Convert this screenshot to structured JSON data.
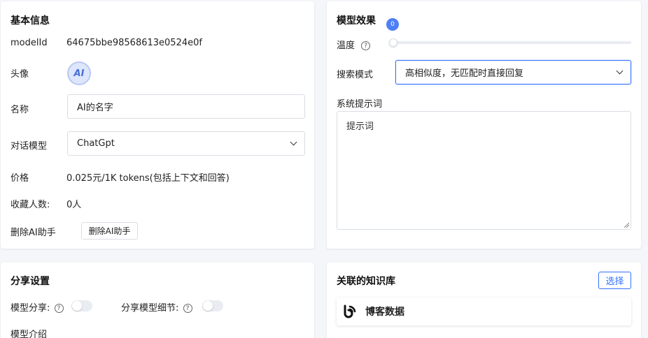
{
  "basic": {
    "title": "基本信息",
    "model_id_label": "modelId",
    "model_id_value": "64675bbe98568613e0524e0f",
    "avatar_label": "头像",
    "avatar_text": "AI",
    "name_label": "名称",
    "name_value": "AI的名字",
    "chat_model_label": "对话模型",
    "chat_model_value": "ChatGpt",
    "price_label": "价格",
    "price_value": "0.025元/1K tokens(包括上下文和回答)",
    "favorites_label": "收藏人数:",
    "favorites_value": "0人",
    "delete_label": "删除AI助手",
    "delete_button": "删除AI助手"
  },
  "effect": {
    "title": "模型效果",
    "temperature_label": "温度",
    "temperature_value": "0",
    "help_glyph": "?",
    "search_mode_label": "搜索模式",
    "search_mode_value": "高相似度，无匹配时直接回复",
    "system_prompt_label": "系统提示词",
    "system_prompt_placeholder": "提示词"
  },
  "share": {
    "title": "分享设置",
    "model_share_label": "模型分享:",
    "model_detail_share_label": "分享模型细节:",
    "model_intro_label": "模型介绍"
  },
  "kb": {
    "title": "关联的知识库",
    "select_button": "选择",
    "item_name": "博客数据"
  },
  "colors": {
    "accent": "#3370ff",
    "badge": "#4e7ff5"
  }
}
